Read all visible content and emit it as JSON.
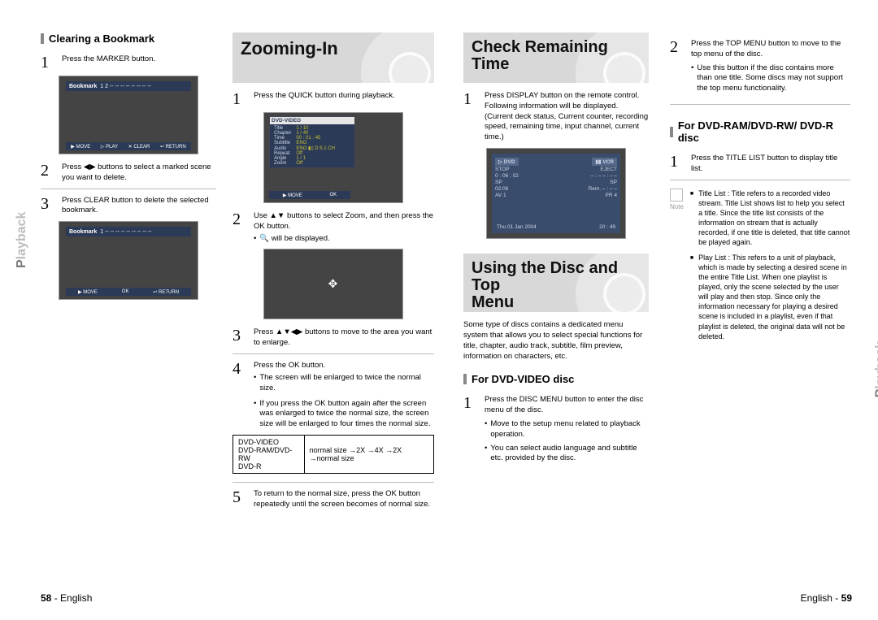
{
  "sidebar_label_first": "P",
  "sidebar_label_rest": "layback",
  "footer_left_page": "58",
  "footer_left_lang": "English",
  "footer_right_lang": "English",
  "footer_right_page": "59",
  "col1": {
    "heading": "Clearing a Bookmark",
    "s1": "Press the MARKER button.",
    "s2": "Press ◀▶ buttons to select a marked scene you want to delete.",
    "s3": "Press CLEAR button to delete the selected bookmark.",
    "shot1": {
      "bookmark": "Bookmark",
      "marks": "1  2  --  --  --  --  --  --  --  --",
      "bar": [
        "▶ MOVE",
        "▷ PLAY",
        "✕ CLEAR",
        "↩ RETURN"
      ]
    },
    "shot2": {
      "bookmark": "Bookmark",
      "marks": "1  --  --  --  --  --  --  --  --  --",
      "bar": [
        "▶ MOVE",
        "OK",
        "↩ RETURN"
      ]
    }
  },
  "col2": {
    "banner": "Zooming-In",
    "s1": "Press the QUICK button during playback.",
    "osd_title": "DVD-VIDEO",
    "osd_rows": [
      [
        "Title",
        "1 / 10"
      ],
      [
        "Chapter",
        "1 / 40"
      ],
      [
        "Time",
        "00 : 01 : 45"
      ],
      [
        "Subtitle",
        "ENG"
      ],
      [
        "Audio",
        "ENG ▮▯ D 5.1 CH"
      ],
      [
        "Repeat",
        "Off"
      ],
      [
        "Angle",
        "1 / 1"
      ],
      [
        "Zoom",
        "Off"
      ]
    ],
    "osd_bar": [
      "▶ MOVE",
      "OK"
    ],
    "s2a": "Use ▲▼ buttons to select Zoom, and then press the OK button.",
    "s2b": "🔍 will be displayed.",
    "shot_center": "✥",
    "s3": "Press ▲▼◀▶ buttons to move to the area you want to enlarge.",
    "s4a": "Press the OK button.",
    "s4b": "The screen will be enlarged to twice the normal size.",
    "s4c": "If you press the OK button again after the screen was enlarged to twice the normal size, the screen size will be enlarged to four times the normal size.",
    "tbl_left": "DVD-VIDEO\nDVD-RAM/DVD-RW\nDVD-R",
    "tbl_right": "normal size →2X →4X →2X →normal size",
    "s5": "To return to the normal size, press the OK button repeatedly until the screen becomes of normal size."
  },
  "col3": {
    "banner1": "Check Remaining Time",
    "s1a": "Press DISPLAY button on the remote control. Following information will be displayed.",
    "s1b": "(Current deck status, Current counter, recording speed, remaining time, input channel, current time.)",
    "dvr": {
      "top_l": "▷ DVD",
      "top_r": "▮▮ VCR",
      "l1": "STOP",
      "l1r": "EJECT",
      "l2": "0 : 06 : 02",
      "l2r": "– : – – : – –",
      "l3": "SP",
      "l3r": "SP",
      "l4": "02:06",
      "l4r": "Rem. – : – –",
      "l5": "AV 1",
      "l5r": "PR   4",
      "date": "Thu 01 Jan 2004",
      "clock": "20 : 49"
    },
    "banner2a": "Using the Disc and Top",
    "banner2b": "Menu",
    "intro": "Some type of discs contains a dedicated menu system that allows you to select special functions for title, chapter, audio track, subtitle, film preview, information on characters, etc.",
    "sub_heading": "For DVD-VIDEO disc",
    "dv1": "Press the DISC MENU button to enter the disc menu of the disc.",
    "dv1a": "Move to the setup menu related to playback operation.",
    "dv1b": "You can select audio language and subtitle etc. provided by the disc."
  },
  "col4": {
    "top2": "Press the TOP MENU button to move to the top menu of the disc.",
    "top2a": "Use this button if the disc contains more than one title. Some discs may not support the top menu functionality.",
    "sub_heading": "For DVD-RAM/DVD-RW/ DVD-R disc",
    "ram1": "Press the TITLE LIST button to display title list.",
    "note_label": "Note",
    "note_title": "Title List : Title refers to a recorded video stream. Title List shows list to help you select a title. Since the title list consists of the information on stream that is actually recorded, if one title is deleted, that title cannot be played again.",
    "note_play": "Play List : This refers to a unit of playback, which is made by selecting a desired scene in the entire Title List. When one playlist is played, only the scene selected by the user will play and then stop. Since only the information necessary for playing a desired scene is included in a playlist, even if that playlist is deleted, the original data will not be deleted."
  }
}
